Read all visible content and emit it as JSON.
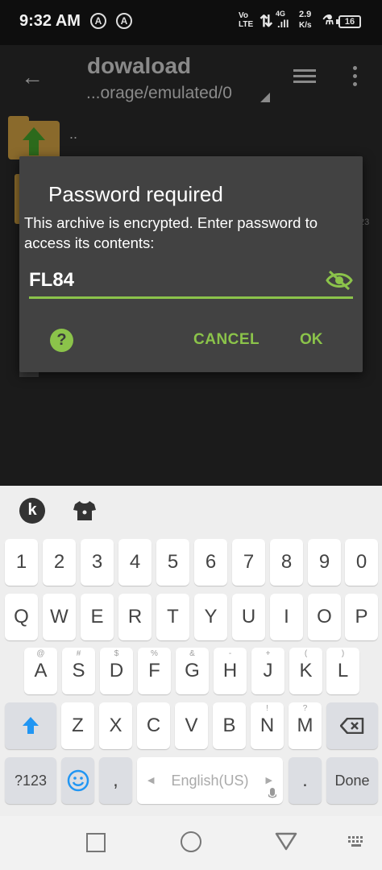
{
  "status_bar": {
    "time": "9:32 AM",
    "network": "Vo LTE",
    "signal": "4G",
    "speed": "2.9",
    "speed_unit": "K/s",
    "battery": "16"
  },
  "app_bar": {
    "title": "dowaload",
    "path": "...orage/emulated/0"
  },
  "file_list": {
    "parent_label": "..",
    "side_text": "23"
  },
  "dialog": {
    "title": "Password required",
    "message": "This archive is encrypted. Enter password to access its contents:",
    "password_value": "FL84",
    "help_label": "?",
    "cancel_label": "CANCEL",
    "ok_label": "OK"
  },
  "colors": {
    "accent": "#8bc34a",
    "dialog_bg": "#424242",
    "background": "#1b1b1b"
  },
  "keyboard": {
    "k_logo": "k",
    "row_numbers": [
      "1",
      "2",
      "3",
      "4",
      "5",
      "6",
      "7",
      "8",
      "9",
      "0"
    ],
    "row_1": [
      "Q",
      "W",
      "E",
      "R",
      "T",
      "Y",
      "U",
      "I",
      "O",
      "P"
    ],
    "row_2": [
      "A",
      "S",
      "D",
      "F",
      "G",
      "H",
      "J",
      "K",
      "L"
    ],
    "row_2_hints": [
      "@",
      "#",
      "$",
      "%",
      "&",
      "-",
      "+",
      "(",
      ")"
    ],
    "row_3": [
      "Z",
      "X",
      "C",
      "V",
      "B",
      "N",
      "M"
    ],
    "row_3_hints": [
      "",
      "",
      "",
      "",
      "",
      "!",
      "?"
    ],
    "bottom": {
      "symbols": "?123",
      "comma": ",",
      "space": "English(US)",
      "period": ".",
      "done": "Done"
    }
  }
}
